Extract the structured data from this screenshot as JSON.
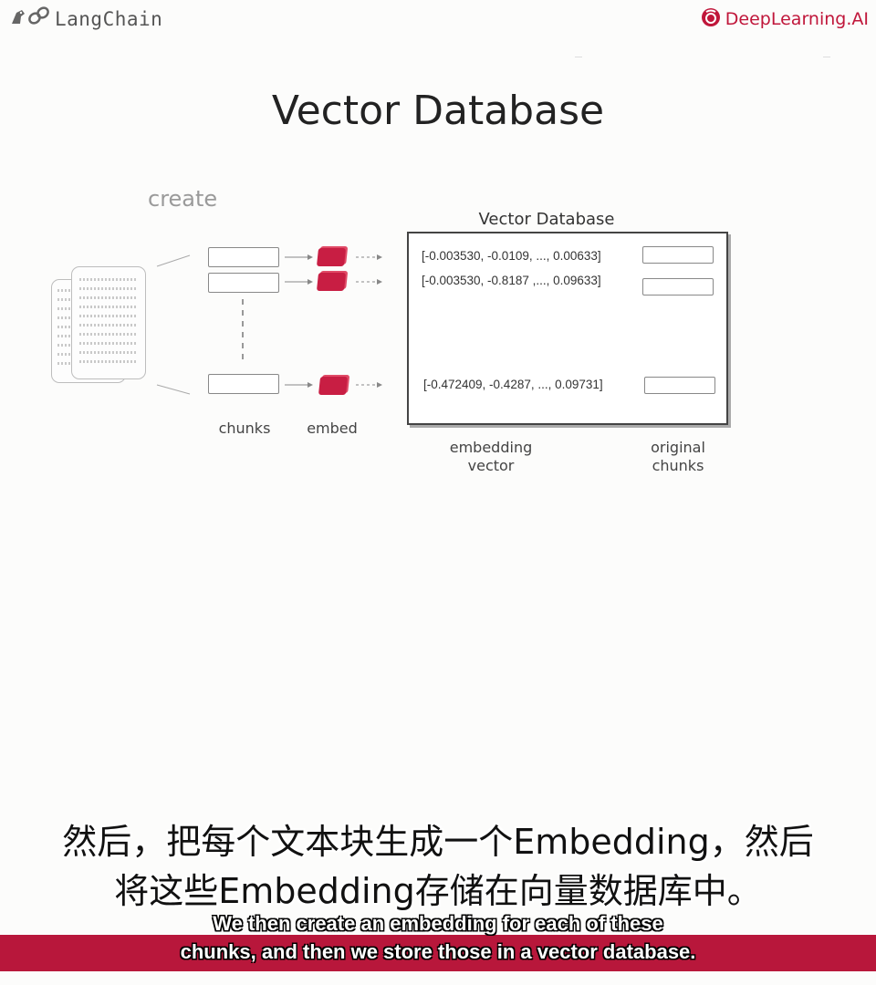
{
  "header": {
    "langchain_logo": {
      "icon": "parrot-chain-icon",
      "text": "LangChain"
    },
    "deeplearning_logo": {
      "icon": "dl-circle-icon",
      "text": "DeepLearning.AI",
      "color": "#c0163a"
    }
  },
  "slide": {
    "title": "Vector Database",
    "create_label": "create",
    "db_title": "Vector Database",
    "vectors": [
      "[-0.003530, -0.0109, ..., 0.00633]",
      "[-0.003530, -0.8187 ,..., 0.09633]",
      "[-0.472409, -0.4287, ..., 0.09731]"
    ],
    "labels": {
      "chunks": "chunks",
      "embed": "embed",
      "embedding_vector_1": "embedding",
      "embedding_vector_2": "vector",
      "original_chunks_1": "original",
      "original_chunks_2": "chunks"
    },
    "accent_color": "#c81e43"
  },
  "subtitles": {
    "chinese_line_1": "然后，把每个文本块生成一个Embedding，然后",
    "chinese_line_2": "将这些Embedding存储在向量数据库中。",
    "english_line_1": "We then create an embedding for each of these",
    "english_line_2": "chunks, and then we store those in a vector database."
  }
}
